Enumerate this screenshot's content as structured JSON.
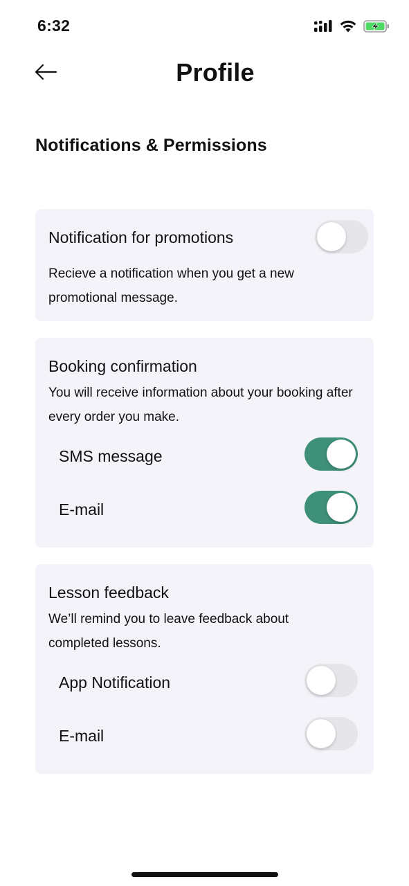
{
  "status_bar": {
    "time": "6:32",
    "icons": [
      "cellular-signal-icon",
      "wifi-icon",
      "battery-charging-icon"
    ],
    "battery_color": "#4cd964"
  },
  "header": {
    "back_icon": "arrow-left-icon",
    "title": "Profile"
  },
  "section": {
    "heading": "Notifications & Permissions"
  },
  "cards": {
    "promotions": {
      "title": "Notification for promotions",
      "description": "Recieve a notification when you get a new promotional message.",
      "toggle_on": false
    },
    "booking": {
      "title": "Booking confirmation",
      "description": "You will receive information about your booking after every order you make.",
      "options": [
        {
          "label": "SMS message",
          "toggle_on": true
        },
        {
          "label": "E-mail",
          "toggle_on": true
        }
      ]
    },
    "feedback": {
      "title": "Lesson feedback",
      "description": "We’ll remind you to leave feedback about completed lessons.",
      "options": [
        {
          "label": "App Notification",
          "toggle_on": false
        },
        {
          "label": "E-mail",
          "toggle_on": false
        }
      ]
    }
  },
  "colors": {
    "toggle_on": "#3e9079",
    "toggle_off": "#e5e5ea",
    "card_background": "#f4f3f9",
    "text": "#111111"
  }
}
